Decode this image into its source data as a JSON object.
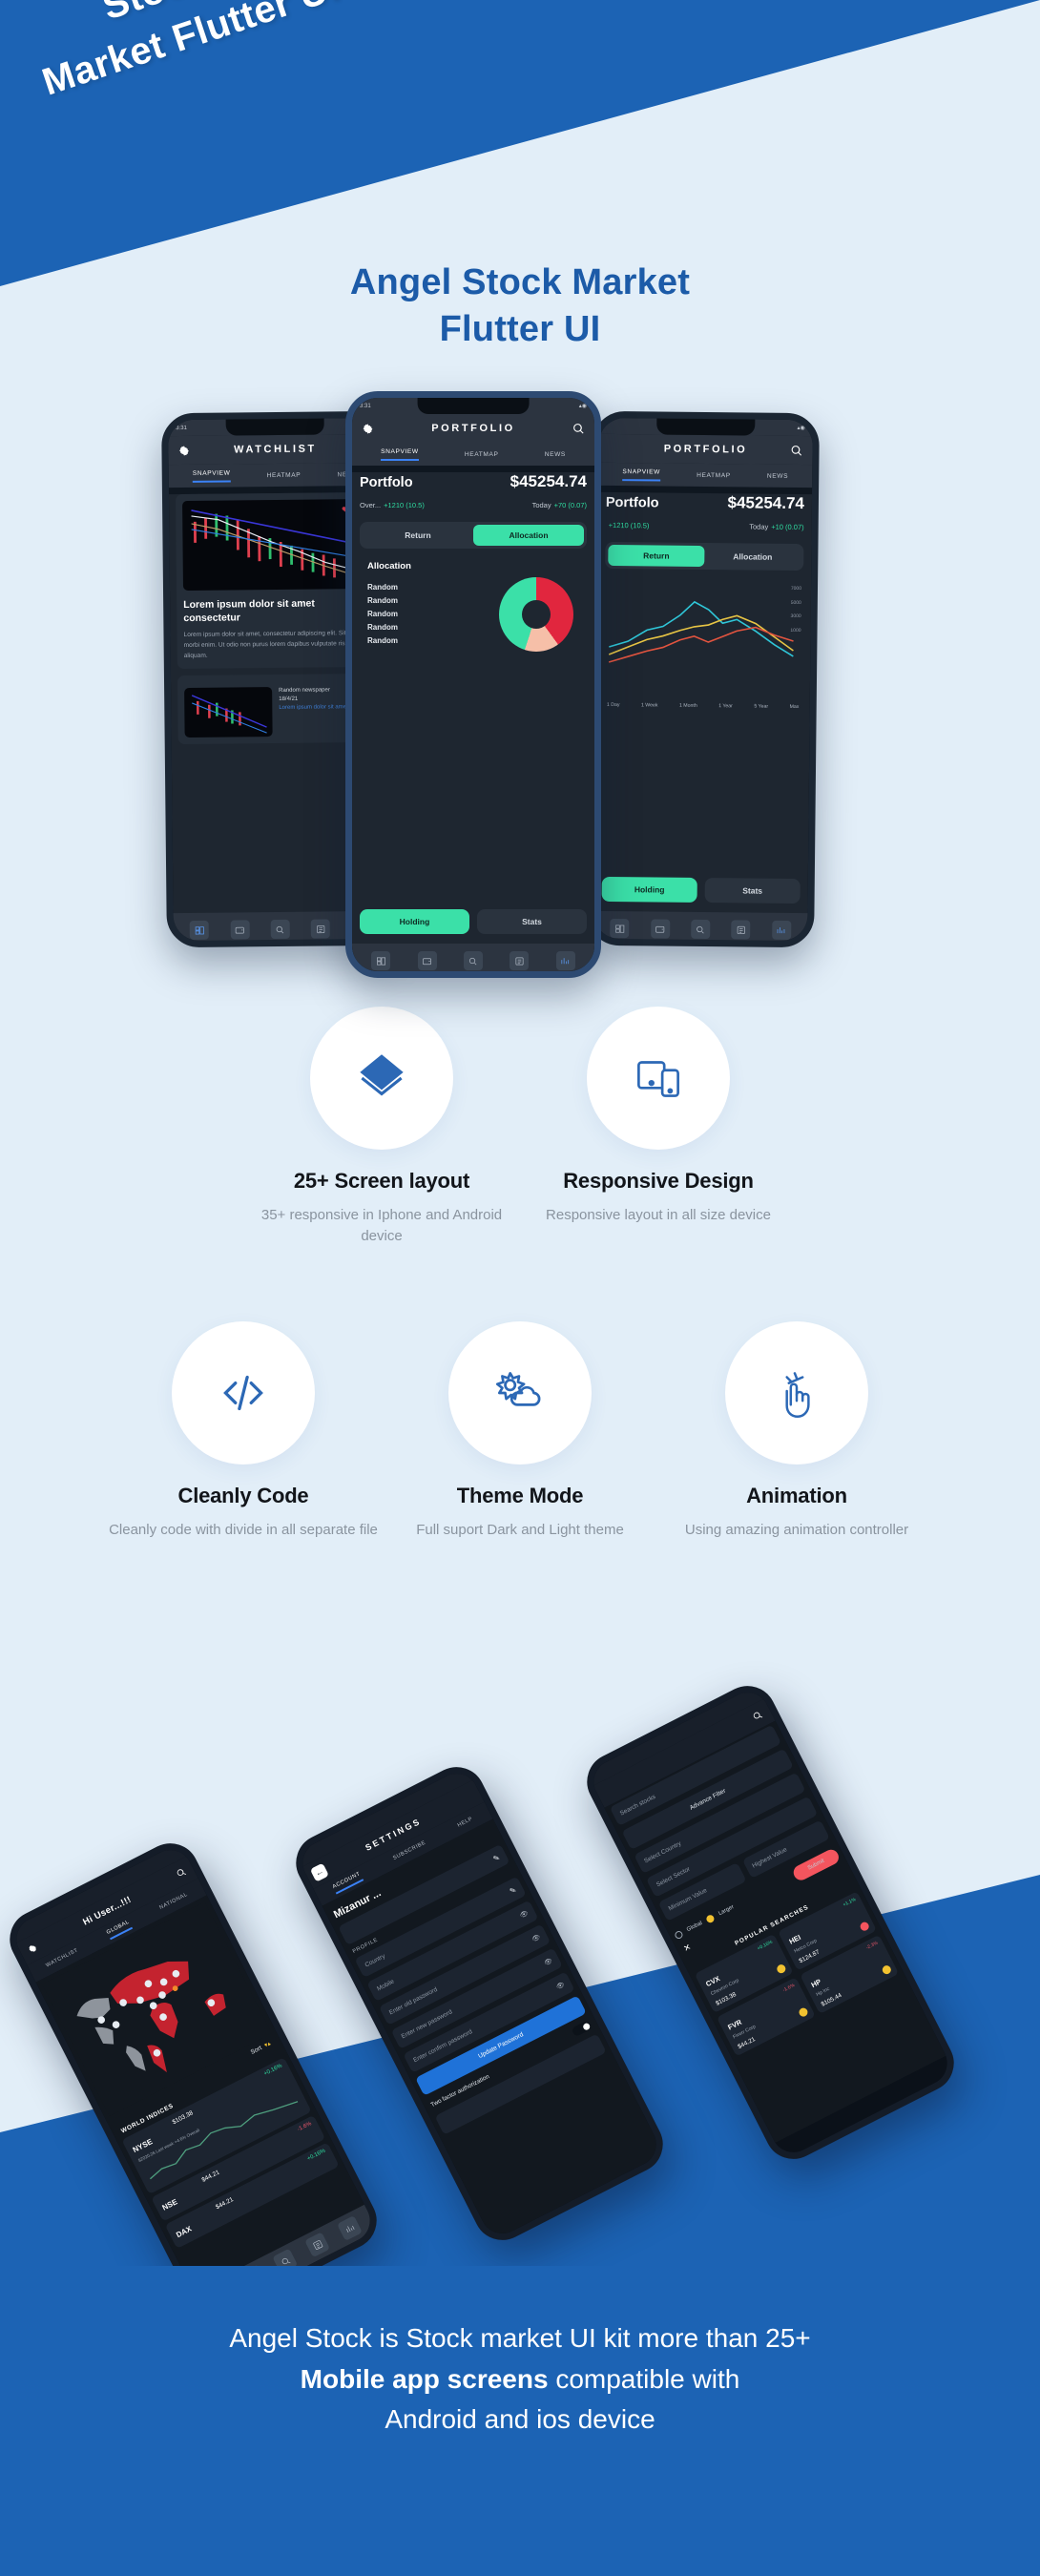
{
  "hero": {
    "line1": "Stock",
    "line2": "Market Flutter UI",
    "brand_blue": "#1c63b4"
  },
  "title": {
    "line1": "Angel Stock Market",
    "line2": "Flutter UI",
    "color": "#1c5ba8"
  },
  "phones": {
    "watchlist": {
      "status_time": "3:31",
      "appbar_title": "WATCHLIST",
      "gear_icon": "gear-icon",
      "search_icon": "search-icon",
      "tabs": [
        "SNAPVIEW",
        "HEATMAP",
        "NEWS"
      ],
      "active_tab": "SNAPVIEW",
      "heart_icon": "heart-icon",
      "headline": "Lorem ipsum dolor sit amet consectetur",
      "body": "Lorem ipsum dolor sit amet, consectetur adipiscing elit. Sit amet morbi enim. Ut odio non purus lorem dapibus vulputate risus aliquam.",
      "news_title": "Random newspaper",
      "news_date": "18/4/21",
      "news_link": "Lorem ipsum dolor sit amet"
    },
    "portfolio": {
      "status_time": "3:31",
      "appbar_title": "PORTFOLIO",
      "gear_icon": "gear-icon",
      "search_icon": "search-icon",
      "tabs": [
        "SNAPVIEW",
        "HEATMAP",
        "NEWS"
      ],
      "active_tab": "SNAPVIEW",
      "name": "Portfolo",
      "value": "$45254.74",
      "overall_label": "Over...",
      "overall_change": "+1210 (10.5)",
      "today_label": "Today",
      "today_change": "+70 (0.07)",
      "segment": [
        "Return",
        "Allocation"
      ],
      "segment_active": "Allocation",
      "alloc_title": "Allocation",
      "alloc_items": [
        "Random",
        "Random",
        "Random",
        "Random",
        "Random"
      ],
      "bottom_segment": [
        "Holding",
        "Stats"
      ],
      "bottom_active": "Holding"
    },
    "portfolio_return": {
      "appbar_title": "PORTFOLIO",
      "search_icon": "search-icon",
      "tabs": [
        "SNAPVIEW",
        "HEATMAP",
        "NEWS"
      ],
      "active_tab": "SNAPVIEW",
      "name": "Portfolo",
      "value": "$45254.74",
      "overall_change": "+1210 (10.5)",
      "today_label": "Today",
      "today_change": "+10 (0.07)",
      "segment": [
        "Return",
        "Allocation"
      ],
      "segment_active": "Return",
      "y_labels": [
        "7000",
        "5000",
        "3000",
        "1000"
      ],
      "ranges": [
        "1 Day",
        "1 Week",
        "1 Month",
        "1 Year",
        "5 Year",
        "Max"
      ],
      "bottom_segment": [
        "Holding",
        "Stats"
      ],
      "bottom_active": "Holding"
    }
  },
  "chart_data": {
    "type": "pie",
    "title": "Allocation",
    "labels": [
      "Random",
      "Random",
      "Random",
      "Random",
      "Random"
    ],
    "values": [
      40,
      15,
      45
    ],
    "colors": [
      "#e1263e",
      "#f6bfa8",
      "#3be0a8"
    ],
    "legend": "left"
  },
  "features": [
    {
      "icon": "layers-icon",
      "title": "25+ Screen layout",
      "desc": "35+ responsive in Iphone and Android device"
    },
    {
      "icon": "devices-icon",
      "title": "Responsive Design",
      "desc": "Responsive layout in all size device"
    },
    {
      "icon": "code-icon",
      "title": "Cleanly Code",
      "desc": "Cleanly code with divide in all separate file"
    },
    {
      "icon": "sun-cloud-icon",
      "title": "Theme Mode",
      "desc": "Full suport Dark and Light theme"
    },
    {
      "icon": "hand-tap-icon",
      "title": "Animation",
      "desc": "Using amazing animation controller"
    }
  ],
  "bottom_phones": {
    "global": {
      "greeting": "Hi User...!!!",
      "gear_icon": "gear-icon",
      "search_icon": "search-icon",
      "tabs": [
        "WATCHLIST",
        "GLOBAL",
        "NATIONAL"
      ],
      "active_tab": "GLOBAL",
      "sort_label": "Sort",
      "sort_icon": "sort-icon",
      "indices_title": "WORLD INDICES",
      "indices": [
        {
          "name": "NYSE",
          "price": "$103.38",
          "change": "+0.16%",
          "dir": "up",
          "meta": "$2020.26 Last week   +4.6%   Overall"
        },
        {
          "name": "NSE",
          "price": "$44.21",
          "change": "-1.6%",
          "dir": "dn",
          "meta": ""
        },
        {
          "name": "DAX",
          "price": "$44.21",
          "change": "+0.16%",
          "dir": "up",
          "meta": ""
        }
      ]
    },
    "settings": {
      "appbar_title": "SETTINGS",
      "back_icon": "back-arrow-icon",
      "tabs": [
        "ACCOUNT",
        "SUBSCRIBE",
        "HELP"
      ],
      "active_tab": "ACCOUNT",
      "user_name": "Mizanur ...",
      "section_label": "PROFILE",
      "fields": [
        {
          "label": "Country",
          "trailing": "pen-icon"
        },
        {
          "label": "Mobile",
          "trailing": "eye-icon"
        },
        {
          "label": "Enter old password",
          "trailing": "eye-icon"
        },
        {
          "label": "Enter new password",
          "trailing": "eye-icon"
        },
        {
          "label": "Enter confirm password",
          "trailing": "eye-icon"
        }
      ],
      "update_button": "Update Password",
      "tfa_label": "Two factor authorization",
      "tfa_on": true
    },
    "search": {
      "search_icon": "search-icon",
      "search_placeholder": "Search stocks",
      "advance_filter": "Advance Filter",
      "select_country": "Select Country",
      "select_sector": "Select Sector",
      "min_value": "Minimum Value",
      "max_value": "Highest Value",
      "radio_global": "Global",
      "radio_larger": "Larger",
      "submit": "Submit",
      "close_icon": "close-icon",
      "popular_label": "POPULAR SEARCHES",
      "stocks": [
        {
          "symbol": "CVX",
          "company": "Chevron Corp",
          "price": "$103.38",
          "change": "+0.16%",
          "dir": "up",
          "badge": "#f2c230"
        },
        {
          "symbol": "HEI",
          "company": "Heico Corp",
          "price": "$124.87",
          "change": "+1.1%",
          "dir": "up",
          "badge": "#f4555e"
        },
        {
          "symbol": "FVR",
          "company": "Fiverr Corp",
          "price": "$44.21",
          "change": "-1.6%",
          "dir": "dn",
          "badge": "#f2c230"
        },
        {
          "symbol": "HP",
          "company": "Hp Inc",
          "price": "$105.44",
          "change": "-2.3%",
          "dir": "dn",
          "badge": "#f2c230"
        }
      ]
    }
  },
  "footer": {
    "line1": "Angel Stock is Stock market UI kit more than 25+",
    "line2_bold": "Mobile app screens",
    "line2_rest": " compatible with",
    "line3": "Android and ios device"
  }
}
